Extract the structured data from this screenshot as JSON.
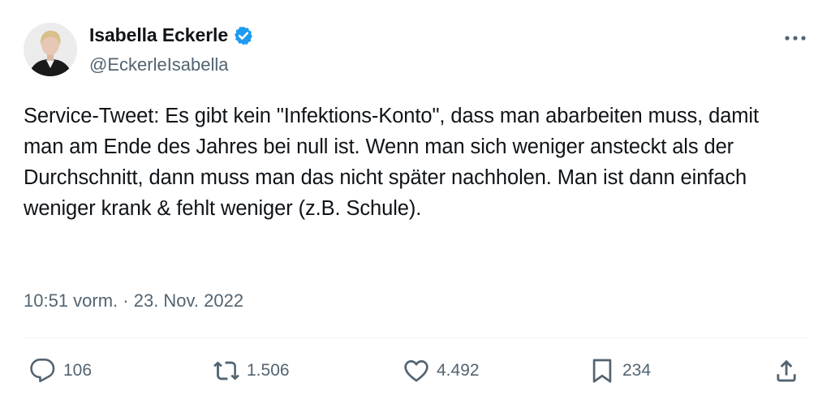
{
  "author": {
    "name": "Isabella Eckerle",
    "handle": "@EckerleIsabella"
  },
  "tweet": {
    "text": "Service-Tweet: Es gibt kein \"Infektions-Konto\", dass man abarbeiten muss, damit man am Ende des Jahres bei null ist. Wenn man sich weniger ansteckt als der Durchschnitt, dann muss man das nicht später nachholen. Man ist dann einfach weniger krank & fehlt weniger (z.B. Schule).",
    "timestamp": "10:51 vorm. · 23. Nov. 2022"
  },
  "actions": {
    "replies": "106",
    "reposts": "1.506",
    "likes": "4.492",
    "bookmarks": "234"
  },
  "colors": {
    "text": "#0f1419",
    "secondary": "#536471",
    "verified": "#1d9bf0",
    "divider": "#eff3f4"
  },
  "icons": [
    "verified-badge-icon",
    "more-icon",
    "reply-icon",
    "repost-icon",
    "like-icon",
    "bookmark-icon",
    "share-icon"
  ]
}
